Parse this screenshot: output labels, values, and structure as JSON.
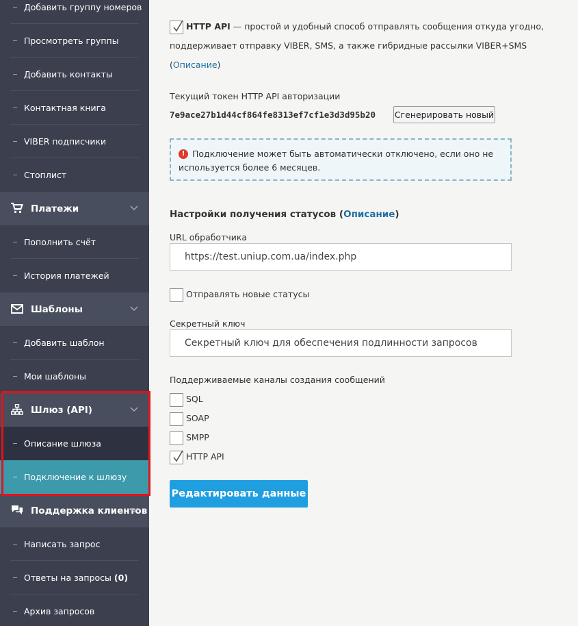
{
  "sidebar": {
    "numbers_items": [
      "Добавить группу номеров",
      "Просмотреть группы",
      "Добавить контакты",
      "Контактная книга",
      "VIBER подписчики",
      "Стоплист"
    ],
    "payments": {
      "title": "Платежи",
      "items": [
        "Пополнить счёт",
        "История платежей"
      ]
    },
    "templates": {
      "title": "Шаблоны",
      "items": [
        "Добавить шаблон",
        "Мои шаблоны"
      ]
    },
    "gateway": {
      "title": "Шлюз (API)",
      "items": [
        "Описание шлюза",
        "Подключение к шлюзу"
      ]
    },
    "support": {
      "title": "Поддержка клиентов",
      "items": [
        "Написать запрос",
        "Ответы на запросы",
        "Архив запросов"
      ],
      "answers_count": "(0)"
    },
    "colors": {
      "bg": "#3b3f4e",
      "group_bg": "#494e5e",
      "active": "#3c9aaa",
      "highlight": "#e0141b"
    }
  },
  "main": {
    "http_api": {
      "checked": true,
      "title": "HTTP API",
      "desc_line1": " — простой и удобный способ отправлять сообщения откуда угодно,",
      "desc_line2": "поддерживает отправку VIBER, SMS, а также гибридные рассылки VIBER+SMS",
      "open_paren": "(",
      "desc_link": "Описание",
      "close_paren": ")"
    },
    "token": {
      "label": "Текущий токен HTTP API авторизации",
      "value": "7e9ace27b1d44cf864fe8313ef7cf1e3d3d95b20",
      "generate_button": "Сгенерировать новый"
    },
    "notice": {
      "text": "Подключение может быть автоматически отключено, если оно не используется более 6 месяцев.",
      "icon_text": "!"
    },
    "status_settings": {
      "title": "Настройки получения статусов",
      "open_paren": "(",
      "link": "Описание",
      "close_paren": ")",
      "url_label": "URL обработчика",
      "url_value": "https://test.uniup.com.ua/index.php",
      "send_new_label": "Отправлять новые статусы",
      "send_new_checked": false,
      "secret_label": "Секретный ключ",
      "secret_placeholder": "Секретный ключ для обеспечения подлинности запросов"
    },
    "channels": {
      "label": "Поддерживаемые каналы создания сообщений",
      "items": [
        {
          "label": "SQL",
          "checked": false
        },
        {
          "label": "SOAP",
          "checked": false
        },
        {
          "label": "SMPP",
          "checked": false
        },
        {
          "label": "HTTP API",
          "checked": true
        }
      ]
    },
    "submit_button": "Редактировать данные"
  }
}
